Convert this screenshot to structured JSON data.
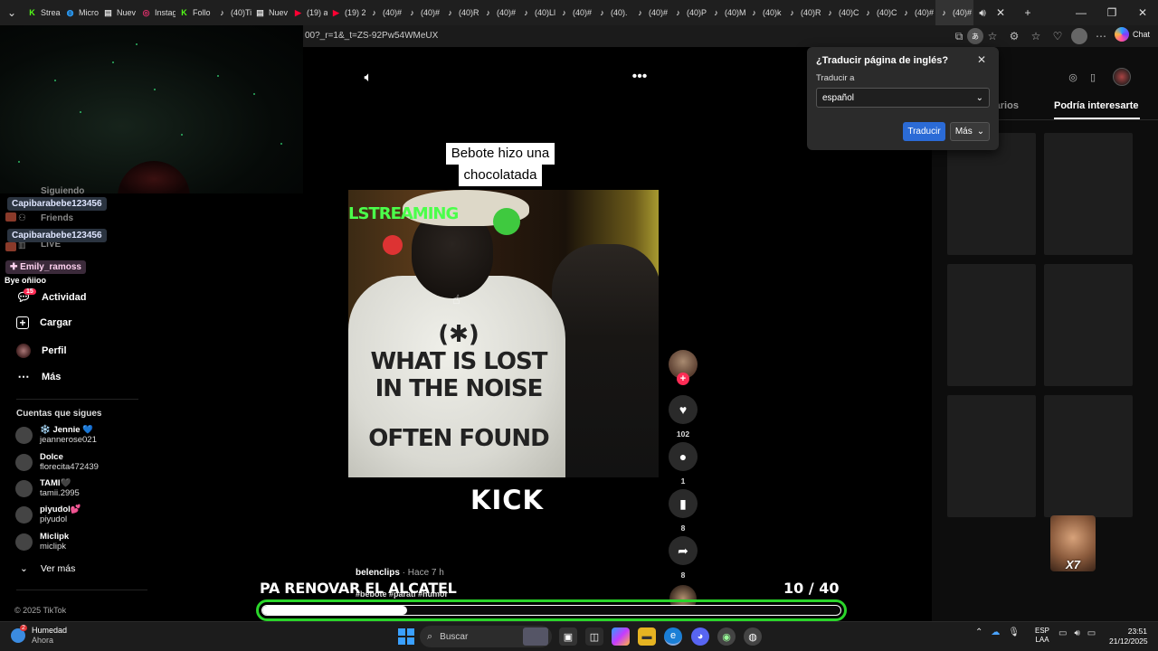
{
  "browser": {
    "tabs": [
      {
        "label": "Strea",
        "icon": "K"
      },
      {
        "label": "Micro",
        "icon": "◍"
      },
      {
        "label": "Nuev",
        "icon": "▤"
      },
      {
        "label": "Instag",
        "icon": "◎"
      },
      {
        "label": "Follo",
        "icon": "K"
      },
      {
        "label": "(40)Ti",
        "icon": "♪"
      },
      {
        "label": "Nuev",
        "icon": "▤"
      },
      {
        "label": "(19) a",
        "icon": "▶"
      },
      {
        "label": "(19) 2",
        "icon": "▶"
      },
      {
        "label": "(40)#",
        "icon": "♪"
      },
      {
        "label": "(40)#",
        "icon": "♪"
      },
      {
        "label": "(40)R",
        "icon": "♪"
      },
      {
        "label": "(40)#",
        "icon": "♪"
      },
      {
        "label": "(40)Ll",
        "icon": "♪"
      },
      {
        "label": "(40)#",
        "icon": "♪"
      },
      {
        "label": "(40).",
        "icon": "♪"
      },
      {
        "label": "(40)#",
        "icon": "♪"
      },
      {
        "label": "(40)P",
        "icon": "♪"
      },
      {
        "label": "(40)M",
        "icon": "♪"
      },
      {
        "label": "(40)k",
        "icon": "♪"
      },
      {
        "label": "(40)R",
        "icon": "♪"
      },
      {
        "label": "(40)C",
        "icon": "♪"
      },
      {
        "label": "(40)C",
        "icon": "♪"
      },
      {
        "label": "(40)#",
        "icon": "♪"
      },
      {
        "label": "(40)#",
        "icon": "♪"
      }
    ],
    "url": "00?_r=1&_t=ZS-92Pw54WMeUX",
    "copilot_label": "Chat"
  },
  "sidebar": {
    "chat_overlay": [
      {
        "user": "Capibarabebe123456"
      },
      {
        "user": "Capibarabebe123456"
      },
      {
        "user": "✚ Emily_ramoss"
      }
    ],
    "chat_message": "Bye oñiioo",
    "nav_partial": [
      "Siguiendo",
      "Friends",
      "LIVE"
    ],
    "nav": [
      {
        "label": "Actividad",
        "icon": "activity-icon",
        "badge": "15"
      },
      {
        "label": "Cargar",
        "icon": "upload-icon"
      },
      {
        "label": "Perfil",
        "icon": "profile-icon"
      },
      {
        "label": "Más",
        "icon": "more-icon"
      }
    ],
    "following_title": "Cuentas que sigues",
    "accounts": [
      {
        "name": "❄️ Jennie 💙",
        "handle": "jeannerose021"
      },
      {
        "name": "Dolce",
        "handle": "florecita472439"
      },
      {
        "name": "TAMI🖤",
        "handle": "tamii.2995"
      },
      {
        "name": "piyudol💕",
        "handle": "piyudol"
      },
      {
        "name": "Miclipk",
        "handle": "miclipk"
      }
    ],
    "see_more": "Ver más",
    "copyright": "© 2025 TikTok"
  },
  "video": {
    "caption_line1": "Bebote hizo una",
    "caption_line2": "chocolatada",
    "frame_text_top": "LSTREAMING",
    "shirt_symbol": "(✱)",
    "shirt_line1": "WHAT IS LOST",
    "shirt_line2": "IN THE NOISE",
    "shirt_line3": "OFTEN FOUND",
    "brand": "KICK",
    "author": "belenclips",
    "time": " · Hace 7 h",
    "hashtags": "#bebote #parati #humor",
    "overlay_text": "PA RENOVAR EL ALCATEL",
    "counter": "10  / 40",
    "progress_fraction": 0.25
  },
  "actions": {
    "likes": "102",
    "comments": "1",
    "saves": "8",
    "shares": "8"
  },
  "right_panel": {
    "tab_comments": "tarios",
    "tab_suggested": "Podría interesarte",
    "meme_text": "X7"
  },
  "translate": {
    "title": "¿Traducir página de inglés?",
    "label": "Traducir a",
    "language": "español",
    "translate_button": "Traducir",
    "more_button": "Más"
  },
  "taskbar": {
    "weather_title": "Humedad",
    "weather_sub": "Ahora",
    "weather_badge": "2",
    "search_placeholder": "Buscar",
    "lang_line1": "ESP",
    "lang_line2": "LAA",
    "time": "23:51",
    "date": "21/12/2025"
  },
  "colors": {
    "tiktok_pink": "#fe2c55",
    "progress_green": "#2bd62b",
    "translate_blue": "#2b6bd6",
    "kick_green": "#4bff4b"
  }
}
